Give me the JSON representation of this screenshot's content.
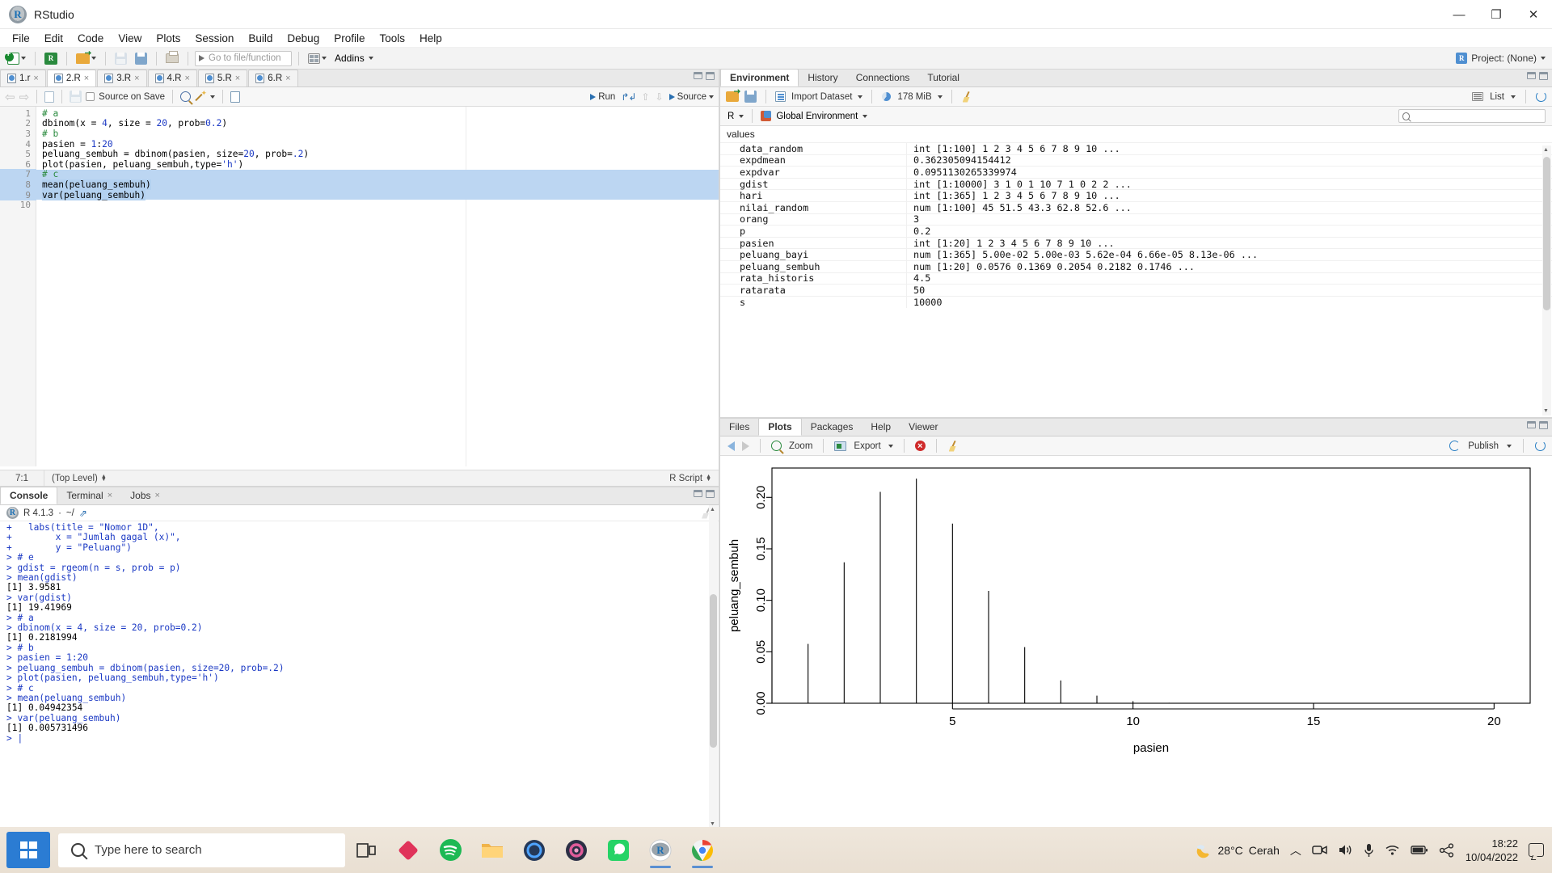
{
  "window": {
    "title": "RStudio",
    "minimize": "—",
    "maximize": "❐",
    "close": "✕"
  },
  "menubar": [
    "File",
    "Edit",
    "Code",
    "View",
    "Plots",
    "Session",
    "Build",
    "Debug",
    "Profile",
    "Tools",
    "Help"
  ],
  "toolbar": {
    "goto_placeholder": "Go to file/function",
    "addins_label": "Addins",
    "project_label": "Project: (None)"
  },
  "source_pane": {
    "tabs": [
      {
        "label": "1.r",
        "active": false
      },
      {
        "label": "2.R",
        "active": true
      },
      {
        "label": "3.R",
        "active": false
      },
      {
        "label": "4.R",
        "active": false
      },
      {
        "label": "5.R",
        "active": false
      },
      {
        "label": "6.R",
        "active": false
      }
    ],
    "editor_toolbar": {
      "source_on_save": "Source on Save",
      "run_label": "Run",
      "source_label": "Source"
    },
    "lines": [
      {
        "n": "1",
        "segments": [
          {
            "t": "# a",
            "c": "cmt"
          }
        ],
        "highlight": false
      },
      {
        "n": "2",
        "segments": [
          {
            "t": "dbinom(x = ",
            "c": ""
          },
          {
            "t": "4",
            "c": "num"
          },
          {
            "t": ", size = ",
            "c": ""
          },
          {
            "t": "20",
            "c": "num"
          },
          {
            "t": ", prob=",
            "c": ""
          },
          {
            "t": "0.2",
            "c": "num"
          },
          {
            "t": ")",
            "c": ""
          }
        ],
        "highlight": false
      },
      {
        "n": "3",
        "segments": [
          {
            "t": "# b",
            "c": "cmt"
          }
        ],
        "highlight": false
      },
      {
        "n": "4",
        "segments": [
          {
            "t": "pasien = ",
            "c": ""
          },
          {
            "t": "1",
            "c": "num"
          },
          {
            "t": ":",
            "c": ""
          },
          {
            "t": "20",
            "c": "num"
          }
        ],
        "highlight": false
      },
      {
        "n": "5",
        "segments": [
          {
            "t": "peluang_sembuh = dbinom(pasien, size=",
            "c": ""
          },
          {
            "t": "20",
            "c": "num"
          },
          {
            "t": ", prob=",
            "c": ""
          },
          {
            "t": ".2",
            "c": "num"
          },
          {
            "t": ")",
            "c": ""
          }
        ],
        "highlight": false
      },
      {
        "n": "6",
        "segments": [
          {
            "t": "plot(pasien, peluang_sembuh,type=",
            "c": ""
          },
          {
            "t": "'h'",
            "c": "str"
          },
          {
            "t": ")",
            "c": ""
          }
        ],
        "highlight": false
      },
      {
        "n": "7",
        "segments": [
          {
            "t": "# c",
            "c": "cmt"
          }
        ],
        "highlight": true
      },
      {
        "n": "8",
        "segments": [
          {
            "t": "mean(peluang_sembuh)",
            "c": "sel"
          }
        ],
        "highlight": true
      },
      {
        "n": "9",
        "segments": [
          {
            "t": "var(peluang_sembuh)",
            "c": "sel"
          }
        ],
        "highlight": true
      },
      {
        "n": "10",
        "segments": [
          {
            "t": "",
            "c": ""
          }
        ],
        "highlight": false
      }
    ],
    "status": {
      "position": "7:1",
      "scope": "(Top Level)",
      "filetype": "R Script"
    }
  },
  "console_pane": {
    "tabs": [
      {
        "label": "Console",
        "active": true,
        "closable": false
      },
      {
        "label": "Terminal",
        "active": false,
        "closable": true
      },
      {
        "label": "Jobs",
        "active": false,
        "closable": true
      }
    ],
    "version_line": "R 4.1.3",
    "path_line": "~/",
    "lines": [
      {
        "t": "+   labs(title = \"Nomor 1D\",",
        "c": "in"
      },
      {
        "t": "+        x = \"Jumlah gagal (x)\",",
        "c": "in"
      },
      {
        "t": "+        y = \"Peluang\")",
        "c": "in"
      },
      {
        "t": "> # e",
        "c": "in"
      },
      {
        "t": "> gdist = rgeom(n = s, prob = p)",
        "c": "in"
      },
      {
        "t": "> mean(gdist)",
        "c": "in"
      },
      {
        "t": "[1] 3.9581",
        "c": "out"
      },
      {
        "t": "> var(gdist)",
        "c": "in"
      },
      {
        "t": "[1] 19.41969",
        "c": "out"
      },
      {
        "t": "> # a",
        "c": "in"
      },
      {
        "t": "> dbinom(x = 4, size = 20, prob=0.2)",
        "c": "in"
      },
      {
        "t": "[1] 0.2181994",
        "c": "out"
      },
      {
        "t": "> # b",
        "c": "in"
      },
      {
        "t": "> pasien = 1:20",
        "c": "in"
      },
      {
        "t": "> peluang_sembuh = dbinom(pasien, size=20, prob=.2)",
        "c": "in"
      },
      {
        "t": "> plot(pasien, peluang_sembuh,type='h')",
        "c": "in"
      },
      {
        "t": "> # c",
        "c": "in"
      },
      {
        "t": "> mean(peluang_sembuh)",
        "c": "in"
      },
      {
        "t": "[1] 0.04942354",
        "c": "out"
      },
      {
        "t": "> var(peluang_sembuh)",
        "c": "in"
      },
      {
        "t": "[1] 0.005731496",
        "c": "out"
      },
      {
        "t": "> |",
        "c": "in"
      }
    ]
  },
  "environment_pane": {
    "tabs": [
      {
        "label": "Environment",
        "active": true
      },
      {
        "label": "History",
        "active": false
      },
      {
        "label": "Connections",
        "active": false
      },
      {
        "label": "Tutorial",
        "active": false
      }
    ],
    "toolbar": {
      "import_label": "Import Dataset",
      "memory_label": "178 MiB",
      "view_label": "List"
    },
    "language": "R",
    "scope": "Global Environment",
    "search_placeholder": "",
    "section_label": "values",
    "rows": [
      {
        "name": "data_random",
        "value": "int [1:100] 1 2 3 4 5 6 7 8 9 10 ..."
      },
      {
        "name": "expdmean",
        "value": "0.362305094154412"
      },
      {
        "name": "expdvar",
        "value": "0.0951130265339974"
      },
      {
        "name": "gdist",
        "value": "int [1:10000] 3 1 0 1 10 7 1 0 2 2 ..."
      },
      {
        "name": "hari",
        "value": "int [1:365] 1 2 3 4 5 6 7 8 9 10 ..."
      },
      {
        "name": "nilai_random",
        "value": "num [1:100] 45 51.5 43.3 62.8 52.6 ..."
      },
      {
        "name": "orang",
        "value": "3"
      },
      {
        "name": "p",
        "value": "0.2"
      },
      {
        "name": "pasien",
        "value": "int [1:20] 1 2 3 4 5 6 7 8 9 10 ..."
      },
      {
        "name": "peluang_bayi",
        "value": "num [1:365] 5.00e-02 5.00e-03 5.62e-04 6.66e-05 8.13e-06 ..."
      },
      {
        "name": "peluang_sembuh",
        "value": "num [1:20] 0.0576 0.1369 0.2054 0.2182 0.1746 ..."
      },
      {
        "name": "rata_historis",
        "value": "4.5"
      },
      {
        "name": "ratarata",
        "value": "50"
      },
      {
        "name": "s",
        "value": "10000"
      }
    ]
  },
  "plots_pane": {
    "tabs": [
      {
        "label": "Files",
        "active": false
      },
      {
        "label": "Plots",
        "active": true
      },
      {
        "label": "Packages",
        "active": false
      },
      {
        "label": "Help",
        "active": false
      },
      {
        "label": "Viewer",
        "active": false
      }
    ],
    "toolbar": {
      "zoom_label": "Zoom",
      "export_label": "Export",
      "publish_label": "Publish"
    }
  },
  "chart_data": {
    "type": "bar",
    "title": "",
    "xlabel": "pasien",
    "ylabel": "peluang_sembuh",
    "xlim": [
      0,
      21
    ],
    "ylim": [
      0,
      0.2285
    ],
    "xticks": [
      5,
      10,
      15,
      20
    ],
    "yticks": [
      0.0,
      0.05,
      0.1,
      0.15,
      0.2
    ],
    "ytick_labels": [
      "0.00",
      "0.05",
      "0.10",
      "0.15",
      "0.20"
    ],
    "xtick_labels": [
      "5",
      "10",
      "15",
      "20"
    ],
    "grid": false,
    "legend": null,
    "x": [
      1,
      2,
      3,
      4,
      5,
      6,
      7,
      8,
      9,
      10,
      11,
      12,
      13,
      14,
      15,
      16,
      17,
      18,
      19,
      20
    ],
    "values": [
      0.05765,
      0.13691,
      0.20536,
      0.2182,
      0.17456,
      0.1091,
      0.05455,
      0.02216,
      0.00739,
      0.00203,
      0.000462,
      8.66e-05,
      1.33e-05,
      1.66e-06,
      1.66e-07,
      1.3e-08,
      7.7e-10,
      3.2e-11,
      8.4e-13,
      1.05e-14
    ],
    "series_name": "peluang_sembuh"
  },
  "taskbar": {
    "search_placeholder": "Type here to search",
    "weather_temp": "28°C",
    "weather_desc": "Cerah",
    "time": "18:22",
    "date": "10/04/2022",
    "apps": [
      {
        "name": "task-view",
        "glyph": "",
        "color": "#2a2a2a"
      },
      {
        "name": "app-diamond",
        "glyph": "",
        "color": "#e03a5f"
      },
      {
        "name": "app-spotify",
        "glyph": "",
        "color": "#1db954"
      },
      {
        "name": "app-explorer",
        "glyph": "",
        "color": "#f5b342"
      },
      {
        "name": "app-cortana",
        "glyph": "",
        "color": "#3d5afe"
      },
      {
        "name": "app-photos",
        "glyph": "",
        "color": "#e05c9a"
      },
      {
        "name": "app-whatsapp",
        "glyph": "",
        "color": "#25d366"
      },
      {
        "name": "app-r",
        "glyph": "R",
        "color": "#276dc3"
      },
      {
        "name": "app-chrome",
        "glyph": "",
        "color": "#4285f4"
      }
    ]
  }
}
